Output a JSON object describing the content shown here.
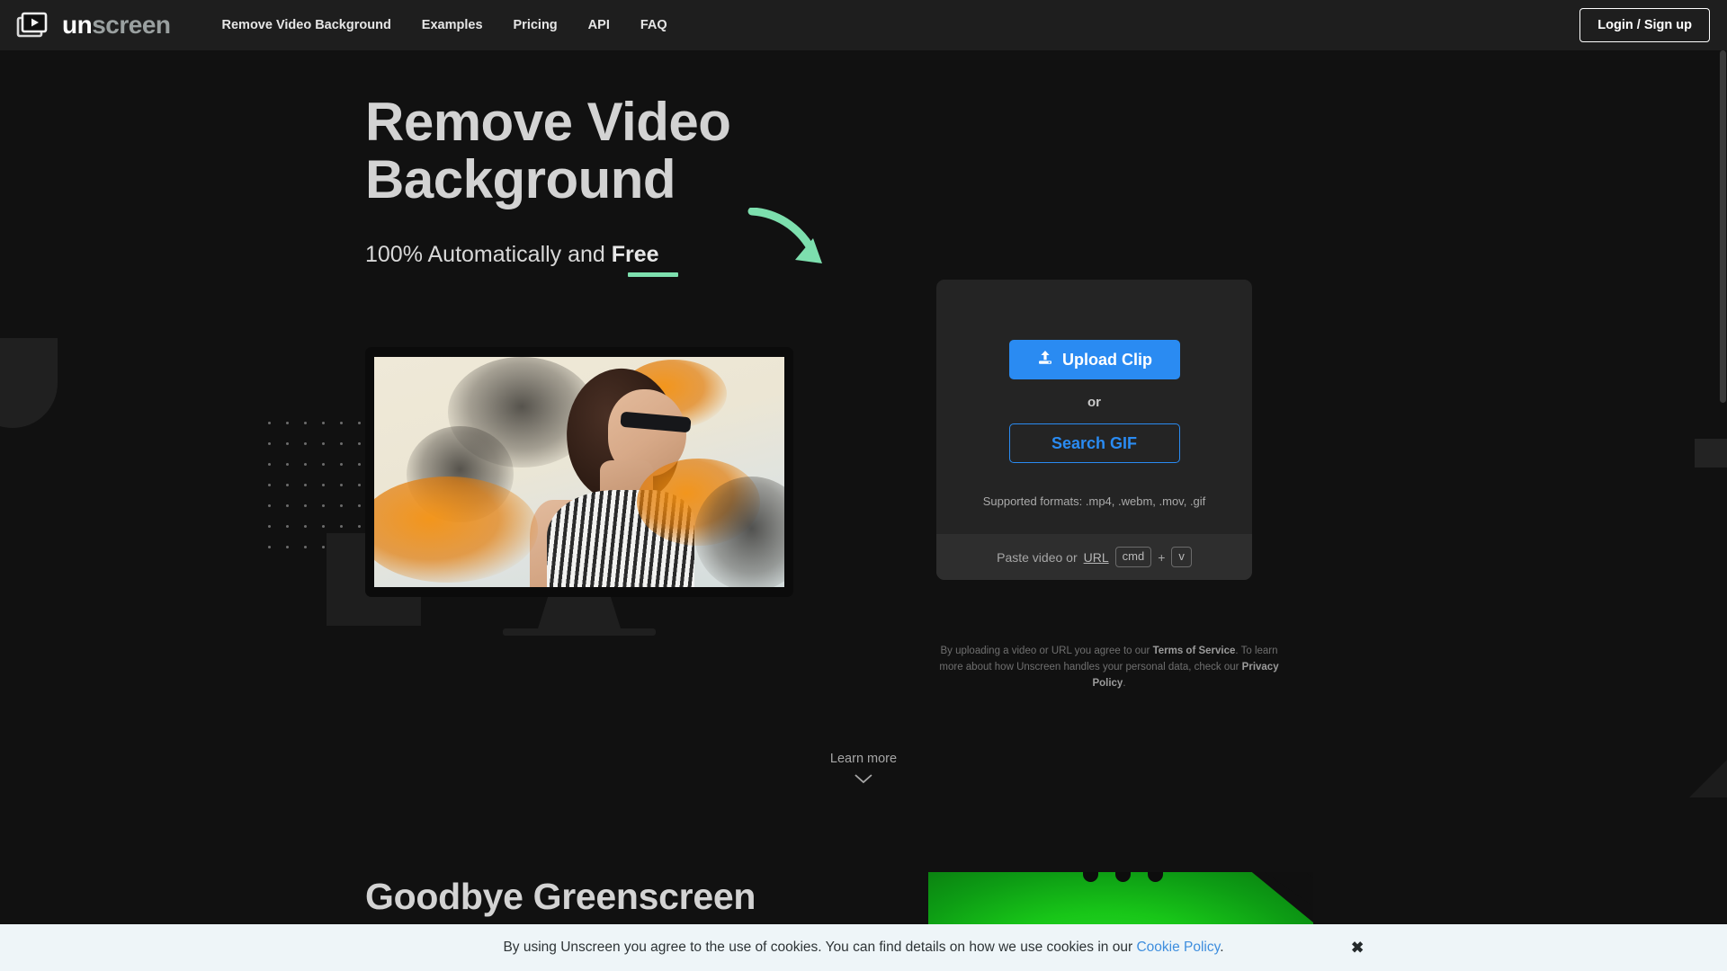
{
  "header": {
    "logo": {
      "part1": "un",
      "part2": "screen",
      "icon": "play-frames-icon"
    },
    "nav": [
      {
        "label": "Remove Video Background"
      },
      {
        "label": "Examples"
      },
      {
        "label": "Pricing"
      },
      {
        "label": "API"
      },
      {
        "label": "FAQ"
      }
    ],
    "login_button": "Login / Sign up"
  },
  "hero": {
    "headline_line1": "Remove Video",
    "headline_line2": "Background",
    "subhead_prefix": "100% Automatically and ",
    "subhead_emphasis": "Free",
    "arrow_color": "#7ddfae",
    "underline_color": "#7ddfae"
  },
  "upload_card": {
    "upload_button": "Upload Clip",
    "upload_icon": "upload-to-device-icon",
    "or_label": "or",
    "search_gif_button": "Search GIF",
    "formats_note": "Supported formats: .mp4, .webm, .mov, .gif",
    "paste_prefix": "Paste video or ",
    "paste_url_link": "URL",
    "key_modifier": "cmd",
    "key_plus": "+",
    "key_letter": "v",
    "accent_color": "#2a8bf2"
  },
  "terms": {
    "line1_a": "By uploading a video or URL you agree to our ",
    "line1_bold": "Terms of Service",
    "line1_b": ". To learn more about",
    "line2_a": "how Unscreen handles your personal data, check our ",
    "line2_bold": "Privacy Policy",
    "line2_b": "."
  },
  "learn_more": {
    "label": "Learn more",
    "icon": "chevron-down-icon"
  },
  "section2": {
    "title": "Goodbye Greenscreen"
  },
  "cookie_banner": {
    "text_before": "By using Unscreen you agree to the use of cookies. You can find details on how we use cookies in our ",
    "link": "Cookie Policy",
    "text_after": ".",
    "close_label": "✖",
    "background": "#eef5f8",
    "link_color": "#3e8ede"
  }
}
